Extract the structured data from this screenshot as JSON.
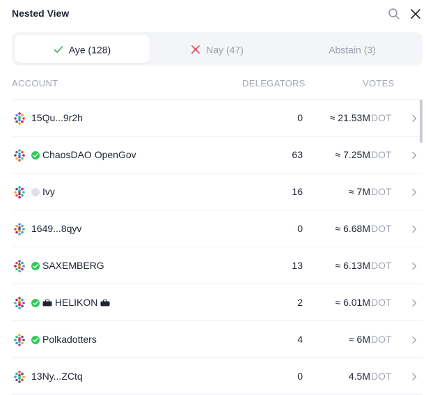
{
  "header": {
    "title": "Nested View",
    "search_icon": "search-icon",
    "close_icon": "close-icon"
  },
  "tabs": [
    {
      "label": "Aye (128)",
      "icon": "check-icon",
      "active": true
    },
    {
      "label": "Nay (47)",
      "icon": "x-icon",
      "active": false
    },
    {
      "label": "Abstain (3)",
      "active": false
    }
  ],
  "columns": {
    "account": "ACCOUNT",
    "delegators": "DELEGATORS",
    "votes": "VOTES"
  },
  "rows": [
    {
      "account": "15Qu...9r2h",
      "delegators": "0",
      "votes": "≈ 21.53M",
      "unit": "DOT"
    },
    {
      "account": "ChaosDAO OpenGov",
      "delegators": "63",
      "votes": "≈ 7.25M",
      "unit": "DOT"
    },
    {
      "account": "Ivy",
      "delegators": "16",
      "votes": "≈ 7M",
      "unit": "DOT"
    },
    {
      "account": "1649...8qyv",
      "delegators": "0",
      "votes": "≈ 6.68M",
      "unit": "DOT"
    },
    {
      "account": "SAXEMBERG",
      "delegators": "13",
      "votes": "≈ 6.13M",
      "unit": "DOT"
    },
    {
      "account": "HELIKON",
      "delegators": "2",
      "votes": "≈ 6.01M",
      "unit": "DOT"
    },
    {
      "account": "Polkadotters",
      "delegators": "4",
      "votes": "≈ 6M",
      "unit": "DOT"
    },
    {
      "account": "13Ny...ZCtq",
      "delegators": "0",
      "votes": "4.5M",
      "unit": "DOT"
    }
  ],
  "colors": {
    "aye": "#3aa55d",
    "nay": "#e5484d",
    "verified": "#34c759",
    "muted": "#a2a8b4"
  }
}
